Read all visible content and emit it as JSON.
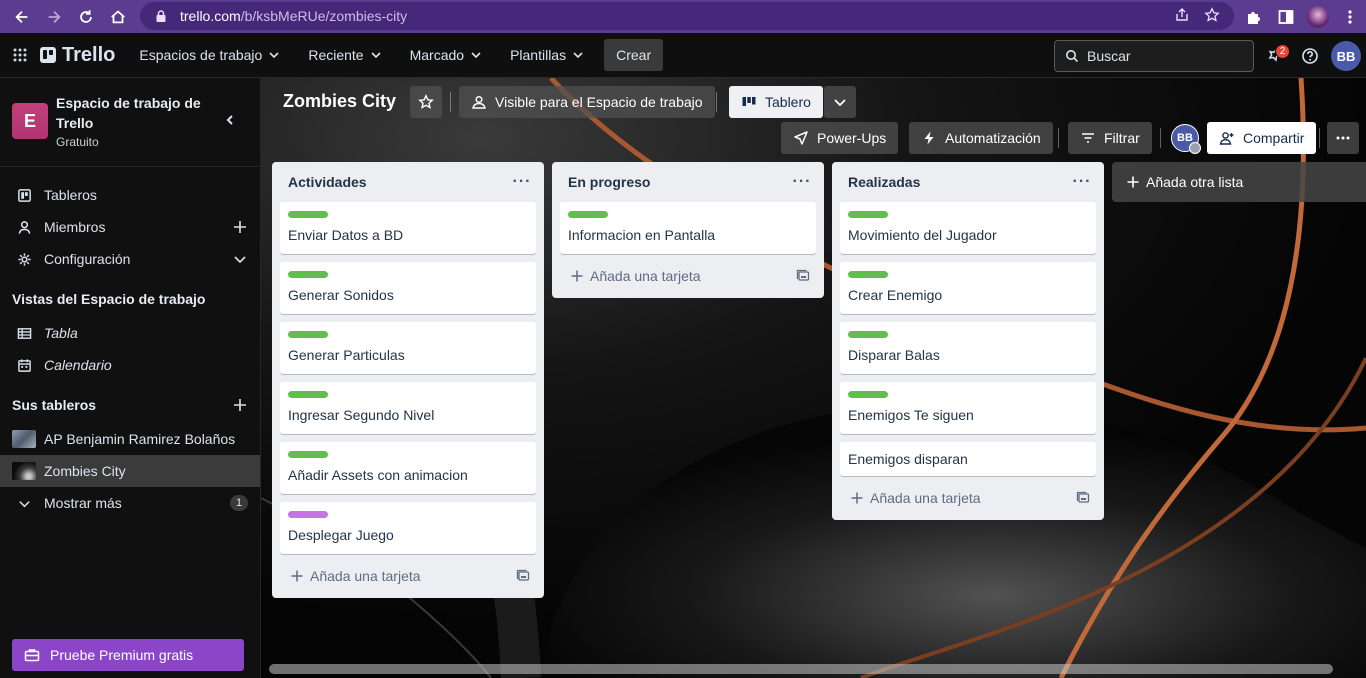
{
  "browser": {
    "url_host": "trello.com",
    "url_path": "/b/ksbMeRUe/zombies-city"
  },
  "header": {
    "logo": "Trello",
    "nav": [
      "Espacios de trabajo",
      "Reciente",
      "Marcado",
      "Plantillas"
    ],
    "create": "Crear",
    "search_placeholder": "Buscar",
    "notification_count": "2",
    "avatar_initials": "BB"
  },
  "sidebar": {
    "workspace_initial": "E",
    "workspace_name": "Espacio de trabajo de Trello",
    "workspace_plan": "Gratuito",
    "items": [
      "Tableros",
      "Miembros",
      "Configuración"
    ],
    "views_heading": "Vistas del Espacio de trabajo",
    "views": [
      "Tabla",
      "Calendario"
    ],
    "boards_heading": "Sus tableros",
    "boards": [
      "AP Benjamin Ramirez Bolaños",
      "Zombies City"
    ],
    "show_more": "Mostrar más",
    "show_more_count": "1",
    "premium": "Pruebe Premium gratis"
  },
  "board": {
    "title": "Zombies City",
    "visibility": "Visible para el Espacio de trabajo",
    "view": "Tablero",
    "powerups": "Power-Ups",
    "automation": "Automatización",
    "filter": "Filtrar",
    "member_initials": "BB",
    "share": "Compartir",
    "add_list": "Añada otra lista",
    "add_card": "Añada una tarjeta",
    "lists": [
      {
        "title": "Actividades",
        "cards": [
          {
            "title": "Enviar Datos a BD",
            "label": "green"
          },
          {
            "title": "Generar Sonidos",
            "label": "green"
          },
          {
            "title": "Generar Particulas",
            "label": "green"
          },
          {
            "title": "Ingresar Segundo Nivel",
            "label": "green"
          },
          {
            "title": "Añadir Assets con animacion",
            "label": "green"
          },
          {
            "title": "Desplegar Juego",
            "label": "purple"
          }
        ]
      },
      {
        "title": "En progreso",
        "cards": [
          {
            "title": "Informacion en Pantalla",
            "label": "green"
          }
        ]
      },
      {
        "title": "Realizadas",
        "cards": [
          {
            "title": "Movimiento del Jugador",
            "label": "green"
          },
          {
            "title": "Crear Enemigo",
            "label": "green"
          },
          {
            "title": "Disparar Balas",
            "label": "green"
          },
          {
            "title": "Enemigos Te siguen",
            "label": "green"
          },
          {
            "title": "Enemigos disparan",
            "label": ""
          }
        ]
      }
    ]
  },
  "colors": {
    "browser_bar": "#5b3c8f",
    "label_green": "#61bd4f",
    "label_purple": "#c377e0",
    "premium": "#8a45c9",
    "workspace_avatar": "#b03470"
  }
}
